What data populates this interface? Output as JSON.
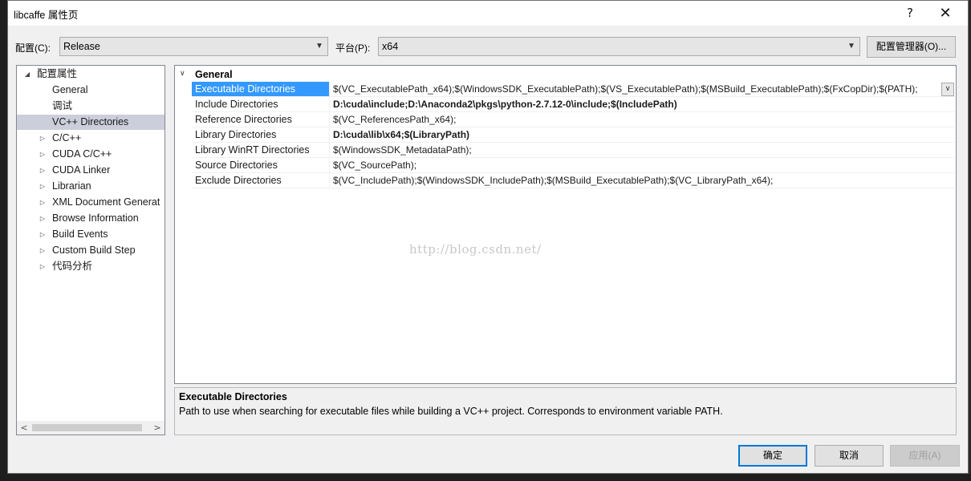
{
  "window": {
    "title": "libcaffe 属性页",
    "help_glyph": "?",
    "close_glyph": "✕"
  },
  "config_bar": {
    "config_label": "配置(C):",
    "config_value": "Release",
    "platform_label": "平台(P):",
    "platform_value": "x64",
    "config_manager_label": "配置管理器(O)..."
  },
  "tree": {
    "items": [
      {
        "label": "配置属性",
        "toggle": "◢",
        "level": 0
      },
      {
        "label": "General",
        "toggle": "",
        "level": 1
      },
      {
        "label": "调试",
        "toggle": "",
        "level": 1
      },
      {
        "label": "VC++ Directories",
        "toggle": "",
        "level": 1,
        "selected": true
      },
      {
        "label": "C/C++",
        "toggle": "▷",
        "level": 1
      },
      {
        "label": "CUDA C/C++",
        "toggle": "▷",
        "level": 1
      },
      {
        "label": "CUDA Linker",
        "toggle": "▷",
        "level": 1
      },
      {
        "label": "Librarian",
        "toggle": "▷",
        "level": 1
      },
      {
        "label": "XML Document Generat",
        "toggle": "▷",
        "level": 1
      },
      {
        "label": "Browse Information",
        "toggle": "▷",
        "level": 1
      },
      {
        "label": "Build Events",
        "toggle": "▷",
        "level": 1
      },
      {
        "label": "Custom Build Step",
        "toggle": "▷",
        "level": 1
      },
      {
        "label": "代码分析",
        "toggle": "▷",
        "level": 1
      }
    ],
    "scroll_left": "<",
    "scroll_right": ">"
  },
  "grid": {
    "category": "General",
    "category_toggle": "∨",
    "dropdown_glyph": "∨",
    "properties": [
      {
        "name": "Executable Directories",
        "value": "$(VC_ExecutablePath_x64);$(WindowsSDK_ExecutablePath);$(VS_ExecutablePath);$(MSBuild_ExecutablePath);$(FxCopDir);$(PATH);",
        "bold": false,
        "selected": true
      },
      {
        "name": "Include Directories",
        "value": "D:\\cuda\\include;D:\\Anaconda2\\pkgs\\python-2.7.12-0\\include;$(IncludePath)",
        "bold": true
      },
      {
        "name": "Reference Directories",
        "value": "$(VC_ReferencesPath_x64);",
        "bold": false
      },
      {
        "name": "Library Directories",
        "value": "D:\\cuda\\lib\\x64;$(LibraryPath)",
        "bold": true
      },
      {
        "name": "Library WinRT Directories",
        "value": "$(WindowsSDK_MetadataPath);",
        "bold": false
      },
      {
        "name": "Source Directories",
        "value": "$(VC_SourcePath);",
        "bold": false
      },
      {
        "name": "Exclude Directories",
        "value": "$(VC_IncludePath);$(WindowsSDK_IncludePath);$(MSBuild_ExecutablePath);$(VC_LibraryPath_x64);",
        "bold": false
      }
    ],
    "watermark": "http://blog.csdn.net/"
  },
  "description": {
    "title": "Executable Directories",
    "text": "Path to use when searching for executable files while building a VC++ project.  Corresponds to environment variable PATH."
  },
  "buttons": {
    "ok": "确定",
    "cancel": "取消",
    "apply": "应用(A)"
  },
  "colors": {
    "selection": "#3399ff",
    "tree_selection": "#cccedb",
    "default_button_border": "#0078d7"
  }
}
